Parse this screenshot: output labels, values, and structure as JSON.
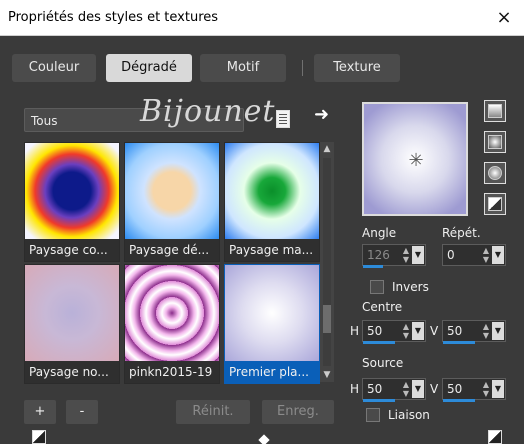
{
  "window": {
    "title": "Propriétés des styles et textures",
    "close_icon": "×"
  },
  "tabs": [
    {
      "label": "Couleur"
    },
    {
      "label": "Dégradé",
      "active": true
    },
    {
      "label": "Motif"
    },
    {
      "label": "Texture"
    }
  ],
  "library": {
    "category": "Tous",
    "watermark_text": "Bijounet",
    "arrow": "➜"
  },
  "gradients": [
    {
      "label": "Paysage co..."
    },
    {
      "label": "Paysage dé..."
    },
    {
      "label": "Paysage ma..."
    },
    {
      "label": "Paysage no..."
    },
    {
      "label": "pinkn2015-19"
    },
    {
      "label": "Premier pla...",
      "selected": true
    }
  ],
  "buttons": {
    "add": "+",
    "remove": "-",
    "reset": "Réinit.",
    "save": "Enreg."
  },
  "params": {
    "angle_label": "Angle",
    "angle_value": "126",
    "repeat_label": "Répét.",
    "repeat_value": "0",
    "invert_label": "Invers",
    "center_label": "Centre",
    "source_label": "Source",
    "h_label": "H",
    "v_label": "V",
    "center_h": "50",
    "center_v": "50",
    "source_h": "50",
    "source_v": "50",
    "link_label": "Liaison"
  },
  "preview": {
    "center_marker": "✳"
  },
  "colors": {
    "accent": "#2d8bd9",
    "selected": "#0a5fb8"
  }
}
